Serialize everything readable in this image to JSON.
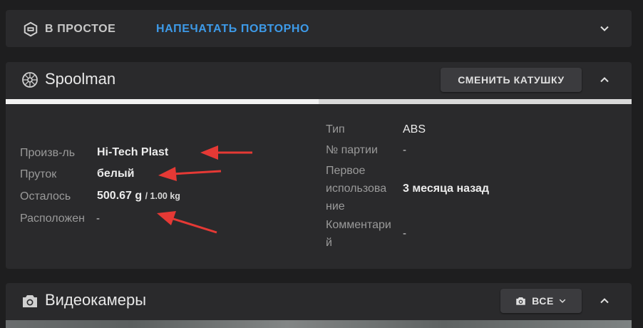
{
  "status_card": {
    "status_label": "В ПРОСТОЕ",
    "reprint_label": "НАПЕЧАТАТЬ ПОВТОРНО"
  },
  "spoolman_card": {
    "title": "Spoolman",
    "change_spool_label": "СМЕНИТЬ КАТУШКУ",
    "remaining_fraction": 0.5,
    "left_fields": [
      {
        "label": "Произв-ль",
        "value": "Hi-Tech Plast"
      },
      {
        "label": "Пруток",
        "value": "белый"
      },
      {
        "label": "Осталось",
        "value": "500.67 g",
        "value_suffix": "/ 1.00 kg"
      },
      {
        "label": "Расположен",
        "value": "-"
      }
    ],
    "right_fields": [
      {
        "label": "Тип",
        "value": "ABS"
      },
      {
        "label": "№ партии",
        "value": "-"
      },
      {
        "label": "Первое использова ние",
        "label_lines": [
          "Первое",
          "использова",
          "ние"
        ],
        "value": "3 месяца назад"
      },
      {
        "label": "Комментари й",
        "label_lines": [
          "Комментари",
          "й"
        ],
        "value": "-"
      }
    ]
  },
  "cameras_card": {
    "title": "Видеокамеры",
    "all_label": "ВСЕ"
  },
  "colors": {
    "accent": "#3d9ae8",
    "annotation_arrow": "#e53935",
    "card_bg": "#2a2a2c",
    "page_bg": "#1e1e1f"
  }
}
